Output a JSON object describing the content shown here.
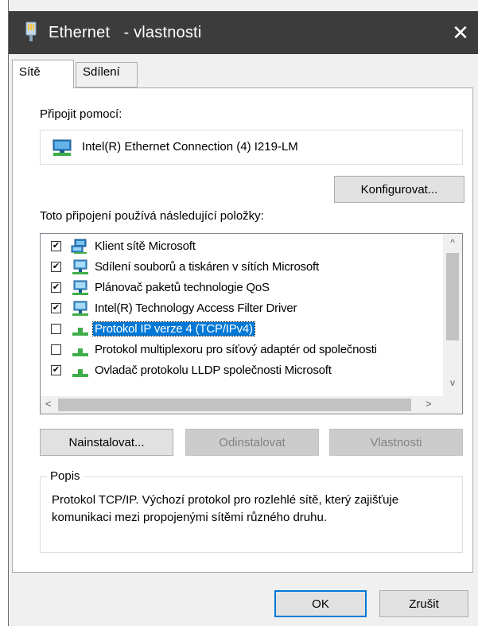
{
  "window": {
    "title": "Ethernet   - vlastnosti",
    "close_glyph": "✕"
  },
  "tabs": [
    {
      "label": "Sítě",
      "active": true
    },
    {
      "label": "Sdílení",
      "active": false
    }
  ],
  "connect": {
    "label": "Připojit pomocí:",
    "adapter_name": "Intel(R) Ethernet Connection (4) I219-LM",
    "adapter_icon": "network-adapter-icon",
    "configure_label": "Konfigurovat..."
  },
  "items_label": "Toto připojení používá následující položky:",
  "items": [
    {
      "label": "Klient sítě Microsoft",
      "checked": true,
      "icon": "network-client-icon",
      "selected": false
    },
    {
      "label": "Sdílení souborů a tiskáren v sítích Microsoft",
      "checked": true,
      "icon": "network-service-icon",
      "selected": false
    },
    {
      "label": "Plánovač paketů technologie QoS",
      "checked": true,
      "icon": "network-service-icon",
      "selected": false
    },
    {
      "label": "Intel(R) Technology Access Filter Driver",
      "checked": true,
      "icon": "network-service-icon",
      "selected": false
    },
    {
      "label": "Protokol IP verze 4 (TCP/IPv4)",
      "checked": false,
      "icon": "protocol-icon",
      "selected": true
    },
    {
      "label": "Protokol multiplexoru pro síťový adaptér od společnosti",
      "checked": false,
      "icon": "protocol-icon",
      "selected": false
    },
    {
      "label": "Ovladač protokolu LLDP společnosti Microsoft",
      "checked": true,
      "icon": "protocol-icon",
      "selected": false
    }
  ],
  "scroll": {
    "up": "^",
    "down": "v",
    "left": "<",
    "right": ">"
  },
  "actions": {
    "install": "Nainstalovat...",
    "uninstall": "Odinstalovat",
    "properties": "Vlastnosti"
  },
  "description": {
    "legend": "Popis",
    "text": "Protokol TCP/IP. Výchozí protokol pro rozlehlé sítě, který zajišťuje komunikaci mezi propojenými sítěmi různého druhu."
  },
  "footer": {
    "ok": "OK",
    "cancel": "Zrušit"
  },
  "colors": {
    "titlebar": "#3c3c3c",
    "selection": "#0078d7",
    "dialog_bg": "#f0f0f0"
  }
}
